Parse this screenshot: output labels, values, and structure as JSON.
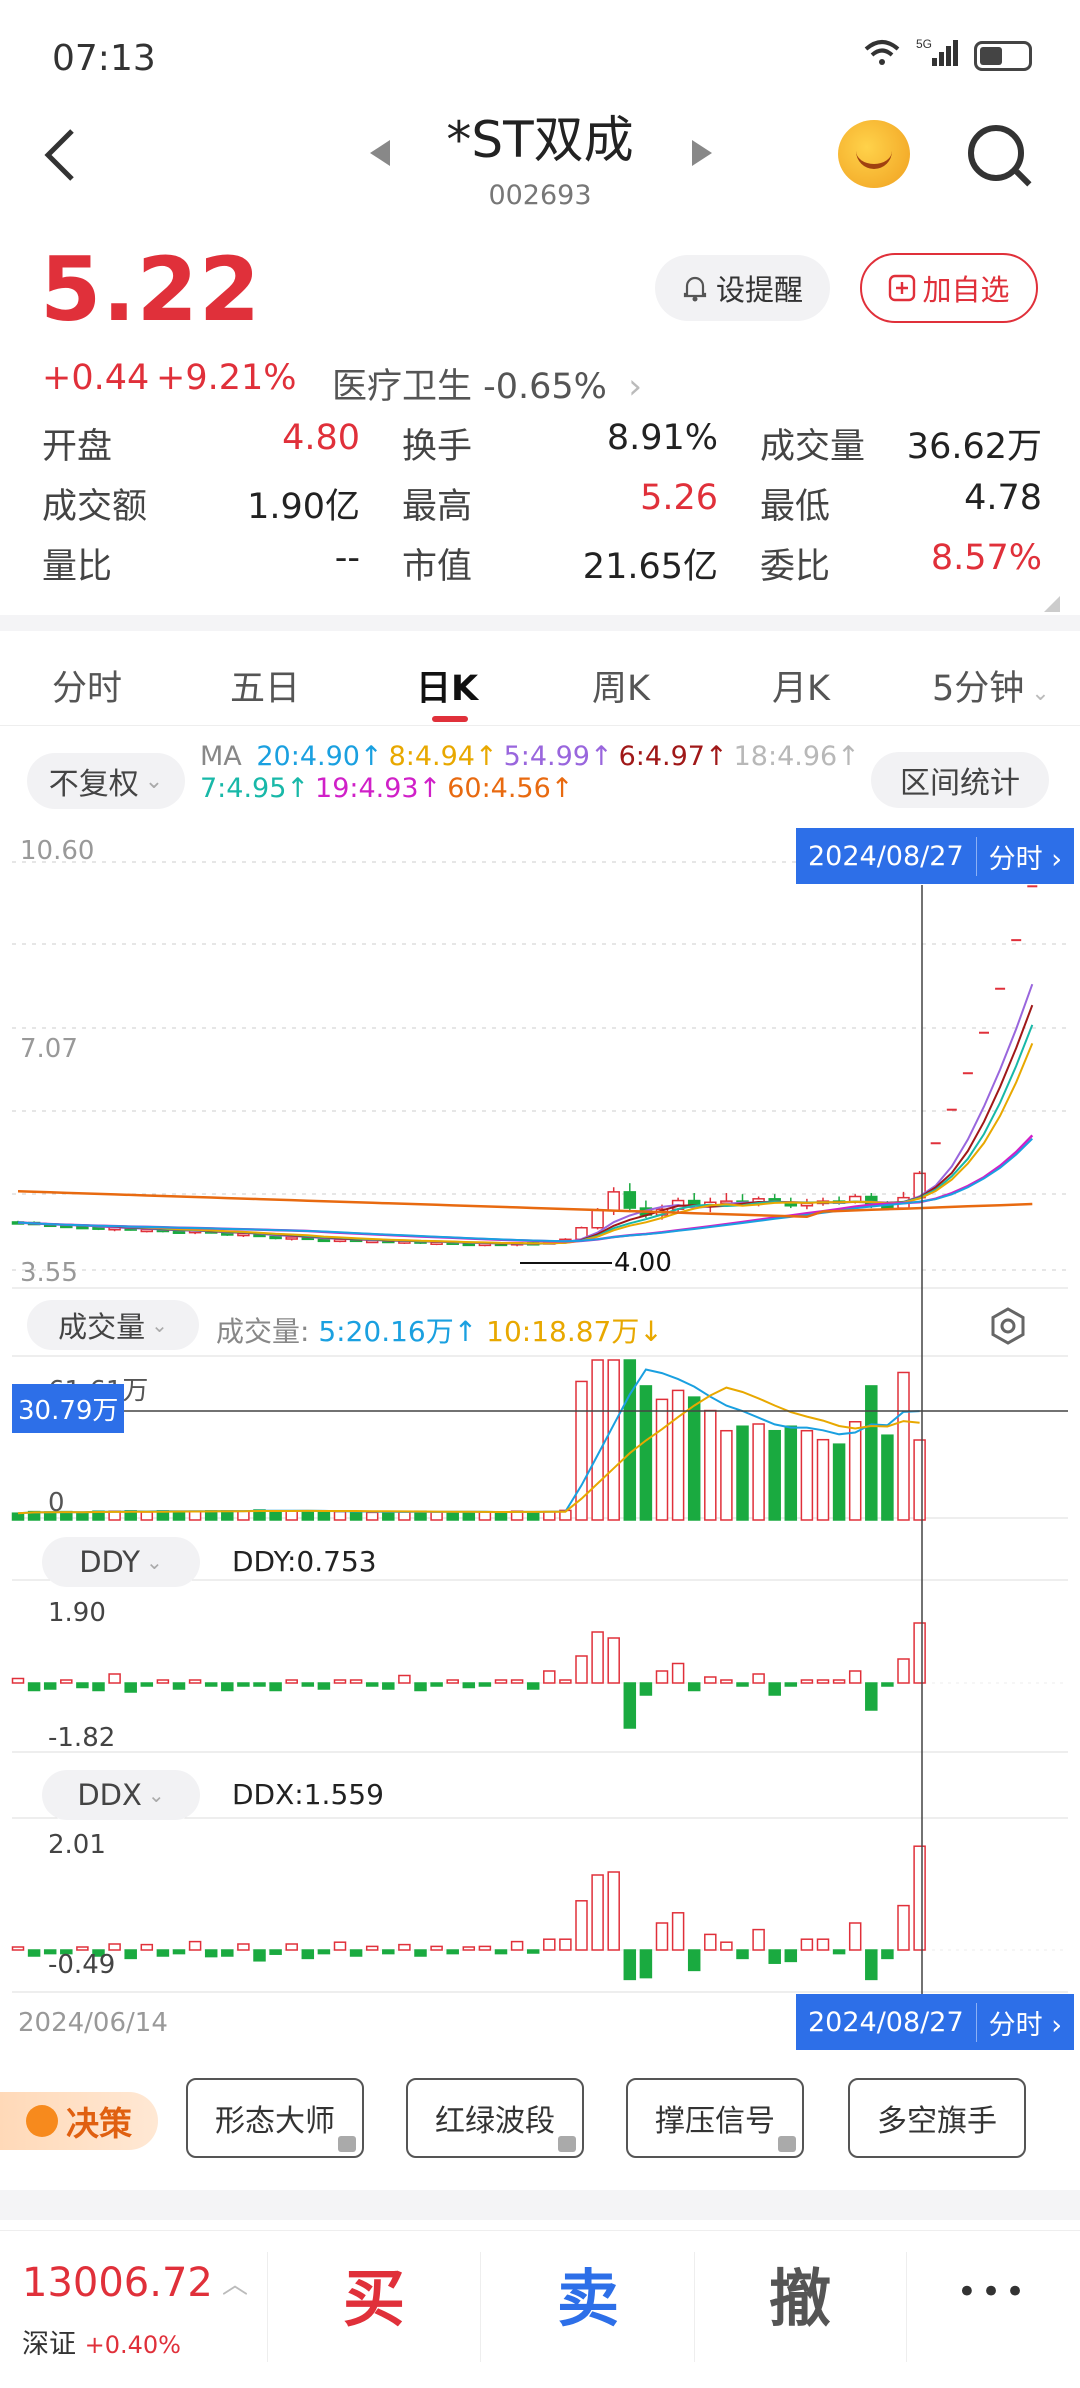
{
  "status": {
    "time": "07:13",
    "network": "5G"
  },
  "header": {
    "title": "*ST双成",
    "code": "002693"
  },
  "quote": {
    "price": "5.22",
    "change": "+0.44",
    "change_pct": "+9.21%",
    "sector": "医疗卫生 -0.65%",
    "alert_label": "设提醒",
    "watch_label": "加自选"
  },
  "stats": [
    [
      {
        "label": "开盘",
        "value": "4.80",
        "color": "#e0303a"
      },
      {
        "label": "换手",
        "value": "8.91%",
        "color": "#222"
      },
      {
        "label": "成交量",
        "value": "36.62万",
        "color": "#222"
      }
    ],
    [
      {
        "label": "成交额",
        "value": "1.90亿",
        "color": "#222"
      },
      {
        "label": "最高",
        "value": "5.26",
        "color": "#e0303a"
      },
      {
        "label": "最低",
        "value": "4.78",
        "color": "#222"
      }
    ],
    [
      {
        "label": "量比",
        "value": "--",
        "color": "#222"
      },
      {
        "label": "市值",
        "value": "21.65亿",
        "color": "#222"
      },
      {
        "label": "委比",
        "value": "8.57%",
        "color": "#e0303a"
      }
    ]
  ],
  "tabs": [
    "分时",
    "五日",
    "日K",
    "周K",
    "月K",
    "5分钟"
  ],
  "active_tab": "日K",
  "kline": {
    "fq_label": "不复权",
    "ma_prefix": "MA",
    "ma_items_row1": [
      {
        "text": "20:4.90↑",
        "color": "#1aa0e0"
      },
      {
        "text": "8:4.94↑",
        "color": "#e8a800"
      },
      {
        "text": "5:4.99↑",
        "color": "#9966dd"
      },
      {
        "text": "6:4.97↑",
        "color": "#a01818"
      },
      {
        "text": "18:4.96↑",
        "color": "#b8b8b8"
      }
    ],
    "ma_items_row2": [
      {
        "text": "7:4.95↑",
        "color": "#18b8a8"
      },
      {
        "text": "19:4.93↑",
        "color": "#d020c8"
      },
      {
        "text": "60:4.56↑",
        "color": "#e86a10"
      }
    ],
    "range_stats_label": "区间统计",
    "y_top": "10.60",
    "y_mid": "7.07",
    "y_bottom": "3.55",
    "low_marker": "4.00",
    "cursor_date": "2024/08/27",
    "cursor_mode": "分时"
  },
  "volume": {
    "selector": "成交量",
    "label": "成交量:",
    "ma5": "5:20.16万↑",
    "ma10": "10:18.87万↓",
    "top_label": "61.61万",
    "cursor_value": "30.79万",
    "zero_label": "0"
  },
  "ddy": {
    "selector": "DDY",
    "value_label": "DDY:0.753",
    "top": "1.90",
    "bottom": "-1.82"
  },
  "ddx": {
    "selector": "DDX",
    "value_label": "DDX:1.559",
    "top": "2.01",
    "bottom": "-0.49"
  },
  "axis_dates": {
    "start": "2024/06/14",
    "cursor": "2024/08/27",
    "mode": "分时"
  },
  "tools": {
    "decision": "决策",
    "items": [
      "形态大师",
      "红绿波段",
      "撑压信号",
      "多空旗手"
    ]
  },
  "bottom_bar": {
    "index_value": "13006.72",
    "index_name": "深证",
    "index_change": "+0.40%",
    "buy": "买",
    "sell": "卖",
    "cancel": "撤",
    "more": "•••"
  },
  "colors": {
    "up": "#e0303a",
    "down": "#1aaa40",
    "accent": "#2d6fe8"
  },
  "chart_data": {
    "type": "candlestick",
    "ylim": [
      3.55,
      10.6
    ],
    "candles": [
      [
        4.38,
        4.4,
        4.36,
        4.37
      ],
      [
        4.37,
        4.39,
        4.33,
        4.34
      ],
      [
        4.34,
        4.36,
        4.3,
        4.32
      ],
      [
        4.32,
        4.35,
        4.28,
        4.3
      ],
      [
        4.3,
        4.33,
        4.27,
        4.29
      ],
      [
        4.29,
        4.31,
        4.24,
        4.26
      ],
      [
        4.26,
        4.3,
        4.22,
        4.28
      ],
      [
        4.28,
        4.3,
        4.23,
        4.24
      ],
      [
        4.24,
        4.27,
        4.2,
        4.25
      ],
      [
        4.25,
        4.28,
        4.2,
        4.22
      ],
      [
        4.22,
        4.25,
        4.18,
        4.2
      ],
      [
        4.2,
        4.24,
        4.17,
        4.23
      ],
      [
        4.23,
        4.25,
        4.18,
        4.19
      ],
      [
        4.19,
        4.22,
        4.14,
        4.16
      ],
      [
        4.16,
        4.2,
        4.12,
        4.18
      ],
      [
        4.18,
        4.2,
        4.12,
        4.13
      ],
      [
        4.13,
        4.16,
        4.08,
        4.1
      ],
      [
        4.1,
        4.14,
        4.06,
        4.12
      ],
      [
        4.12,
        4.14,
        4.07,
        4.08
      ],
      [
        4.08,
        4.11,
        4.04,
        4.06
      ],
      [
        4.06,
        4.1,
        4.03,
        4.08
      ],
      [
        4.08,
        4.1,
        4.04,
        4.05
      ],
      [
        4.05,
        4.08,
        4.02,
        4.06
      ],
      [
        4.06,
        4.08,
        4.02,
        4.04
      ],
      [
        4.04,
        4.07,
        4.0,
        4.05
      ],
      [
        4.05,
        4.07,
        4.0,
        4.02
      ],
      [
        4.02,
        4.05,
        3.98,
        4.03
      ],
      [
        4.03,
        4.05,
        3.99,
        4.01
      ],
      [
        4.01,
        4.04,
        3.97,
        4.0
      ],
      [
        4.0,
        4.03,
        3.96,
        4.01
      ],
      [
        4.01,
        4.02,
        3.97,
        3.99
      ],
      [
        3.99,
        4.03,
        3.96,
        4.02
      ],
      [
        4.02,
        4.04,
        3.98,
        4.0
      ],
      [
        4.0,
        4.05,
        4.0,
        4.04
      ],
      [
        4.04,
        4.1,
        4.02,
        4.08
      ],
      [
        4.08,
        4.3,
        4.06,
        4.28
      ],
      [
        4.28,
        4.62,
        4.25,
        4.58
      ],
      [
        4.58,
        4.98,
        4.5,
        4.9
      ],
      [
        4.9,
        5.05,
        4.55,
        4.62
      ],
      [
        4.62,
        4.75,
        4.45,
        4.5
      ],
      [
        4.5,
        4.68,
        4.42,
        4.6
      ],
      [
        4.6,
        4.8,
        4.55,
        4.75
      ],
      [
        4.75,
        4.88,
        4.6,
        4.66
      ],
      [
        4.66,
        4.8,
        4.55,
        4.72
      ],
      [
        4.72,
        4.88,
        4.68,
        4.74
      ],
      [
        4.74,
        4.86,
        4.66,
        4.7
      ],
      [
        4.7,
        4.82,
        4.65,
        4.78
      ],
      [
        4.78,
        4.86,
        4.7,
        4.72
      ],
      [
        4.72,
        4.8,
        4.62,
        4.66
      ],
      [
        4.66,
        4.78,
        4.6,
        4.7
      ],
      [
        4.7,
        4.8,
        4.66,
        4.74
      ],
      [
        4.74,
        4.82,
        4.68,
        4.72
      ],
      [
        4.72,
        4.86,
        4.7,
        4.82
      ],
      [
        4.82,
        4.88,
        4.62,
        4.66
      ],
      [
        4.66,
        4.74,
        4.58,
        4.62
      ],
      [
        4.62,
        4.9,
        4.6,
        4.8
      ],
      [
        4.8,
        5.26,
        4.78,
        5.22
      ]
    ],
    "limit_up_projection": [
      5.74,
      6.32,
      6.95,
      7.65,
      8.41,
      9.25,
      10.18
    ]
  }
}
